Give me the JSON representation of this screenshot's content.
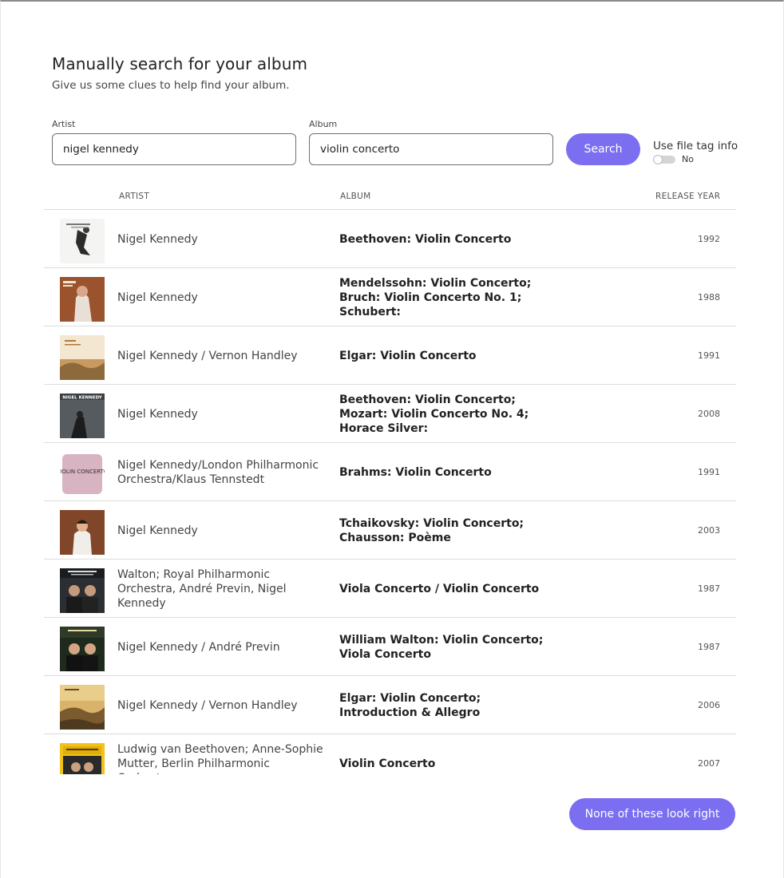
{
  "header": {
    "title": "Manually search for your album",
    "subtitle": "Give us some clues to help find your album."
  },
  "form": {
    "artist_label": "Artist",
    "artist_value": "nigel kennedy",
    "album_label": "Album",
    "album_value": "violin concerto",
    "search_label": "Search",
    "tag_label": "Use file tag info",
    "tag_state": "No"
  },
  "columns": {
    "artist": "ARTIST",
    "album": "ALBUM",
    "year": "RELEASE YEAR"
  },
  "results": [
    {
      "artist": "Nigel Kennedy",
      "album": "Beethoven: Violin Concerto",
      "year": "1992",
      "cover": "cover-art-icon"
    },
    {
      "artist": "Nigel Kennedy",
      "album": "Mendelssohn: Violin Concerto; Bruch: Violin Concerto No. 1; Schubert:",
      "year": "1988",
      "cover": "cover-art-icon"
    },
    {
      "artist": "Nigel Kennedy / Vernon Handley",
      "album": "Elgar: Violin Concerto",
      "year": "1991",
      "cover": "cover-art-icon"
    },
    {
      "artist": "Nigel Kennedy",
      "album": "Beethoven: Violin Concerto; Mozart: Violin Concerto No. 4; Horace Silver:",
      "year": "2008",
      "cover": "cover-art-icon",
      "cover_text": "NIGEL KENNEDY"
    },
    {
      "artist": "Nigel Kennedy/London Philharmonic Orchestra/Klaus Tennstedt",
      "album": "Brahms: Violin Concerto",
      "year": "1991",
      "cover": "cover-art-icon",
      "cover_text": "VIOLIN CONCERTO"
    },
    {
      "artist": "Nigel Kennedy",
      "album": "Tchaikovsky: Violin Concerto; Chausson: Poème",
      "year": "2003",
      "cover": "cover-art-icon"
    },
    {
      "artist": "Walton; Royal Philharmonic Orchestra, André Previn, Nigel Kennedy",
      "album": "Viola Concerto / Violin Concerto",
      "year": "1987",
      "cover": "cover-art-icon"
    },
    {
      "artist": "Nigel Kennedy / André Previn",
      "album": "William Walton: Violin Concerto; Viola Concerto",
      "year": "1987",
      "cover": "cover-art-icon"
    },
    {
      "artist": "Nigel Kennedy / Vernon Handley",
      "album": "Elgar: Violin Concerto; Introduction & Allegro",
      "year": "2006",
      "cover": "cover-art-icon"
    },
    {
      "artist": "Ludwig van Beethoven; Anne-Sophie Mutter, Berlin Philharmonic Orchestra,",
      "album": "Violin Concerto",
      "year": "2007",
      "cover": "cover-art-icon"
    }
  ],
  "footer": {
    "none_label": "None of these look right"
  },
  "colors": {
    "accent": "#7b6ef0",
    "divider": "#dcdcdc"
  }
}
